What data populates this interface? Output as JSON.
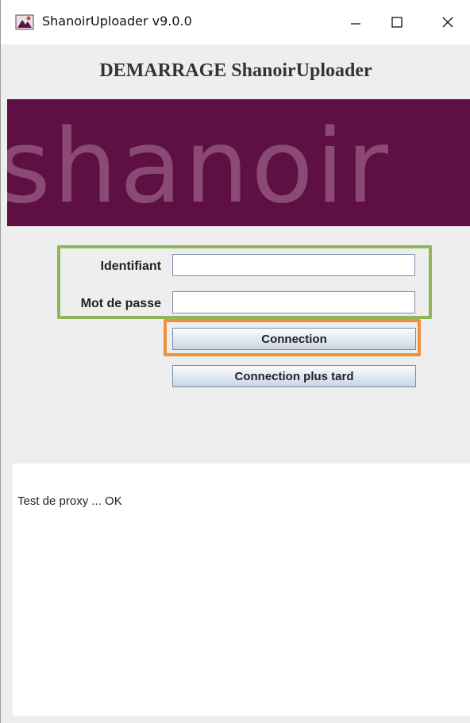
{
  "window": {
    "title": "ShanoirUploader v9.0.0",
    "controls": [
      "minimize-icon",
      "maximize-icon",
      "close-icon"
    ]
  },
  "header": {
    "title": "DEMARRAGE ShanoirUploader"
  },
  "banner": {
    "logo_text": "shanoir",
    "background_color": "#5e0f44",
    "text_color": "#8a4a74"
  },
  "login": {
    "username_label": "Identifiant",
    "username_value": "",
    "password_label": "Mot de passe",
    "password_value": "",
    "connect_label": "Connection",
    "connect_later_label": "Connection plus tard"
  },
  "log": {
    "lines": [
      "Test de proxy ... OK"
    ]
  },
  "highlights": {
    "credentials_color": "#92b55a",
    "connect_color": "#f0903c"
  }
}
